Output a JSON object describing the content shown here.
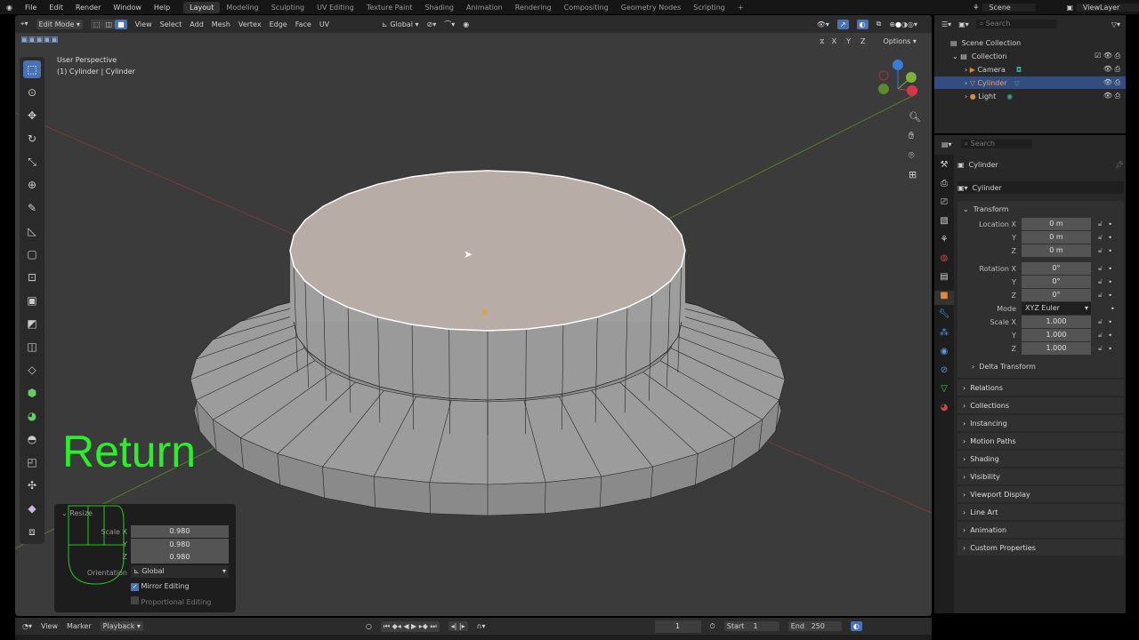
{
  "menu": [
    "File",
    "Edit",
    "Render",
    "Window",
    "Help"
  ],
  "workspaces": [
    "Layout",
    "Modeling",
    "Sculpting",
    "UV Editing",
    "Texture Paint",
    "Shading",
    "Animation",
    "Rendering",
    "Compositing",
    "Geometry Nodes",
    "Scripting",
    "+"
  ],
  "scene": "Scene",
  "view_layer": "ViewLayer",
  "header": {
    "mode": "Edit Mode",
    "menus": [
      "View",
      "Select",
      "Add",
      "Mesh",
      "Vertex",
      "Edge",
      "Face",
      "UV"
    ],
    "orientation": "Global",
    "options": "Options",
    "axes": [
      "X",
      "Y",
      "Z"
    ]
  },
  "viewport": {
    "view_name": "User Perspective",
    "object_info": "(1) Cylinder | Cylinder",
    "overlay_text": "Return"
  },
  "redo_panel": {
    "title": "Resize",
    "scale_label": "Scale X",
    "y_label": "Y",
    "z_label": "Z",
    "scale": [
      "0.980",
      "0.980",
      "0.980"
    ],
    "orientation_label": "Orientation",
    "orientation": "Global",
    "mirror": "Mirror Editing",
    "proportional": "Proportional Editing"
  },
  "outliner": {
    "search": "Search",
    "scene_collection": "Scene Collection",
    "collection": "Collection",
    "items": [
      "Camera",
      "Cylinder",
      "Light"
    ]
  },
  "properties": {
    "search": "Search",
    "object": "Cylinder",
    "data_name": "Cylinder",
    "transform": "Transform",
    "location_label": "Location X",
    "rotation_label": "Rotation X",
    "scale_label": "Scale X",
    "y": "Y",
    "z": "Z",
    "location": [
      "0 m",
      "0 m",
      "0 m"
    ],
    "rotation": [
      "0°",
      "0°",
      "0°"
    ],
    "mode_label": "Mode",
    "mode": "XYZ Euler",
    "scale": [
      "1.000",
      "1.000",
      "1.000"
    ],
    "delta": "Delta Transform",
    "panels": [
      "Relations",
      "Collections",
      "Instancing",
      "Motion Paths",
      "Shading",
      "Visibility",
      "Viewport Display",
      "Line Art",
      "Animation",
      "Custom Properties"
    ]
  },
  "timeline": {
    "menus": [
      "View",
      "Marker",
      "Playback"
    ],
    "frame": "1",
    "start_label": "Start",
    "start": "1",
    "end_label": "End",
    "end": "250"
  },
  "colors": {
    "accent": "#4772b3",
    "overlay_green": "#2bef2b",
    "face_selected": "#b8aca6",
    "mesh": "#9b9b9b"
  }
}
